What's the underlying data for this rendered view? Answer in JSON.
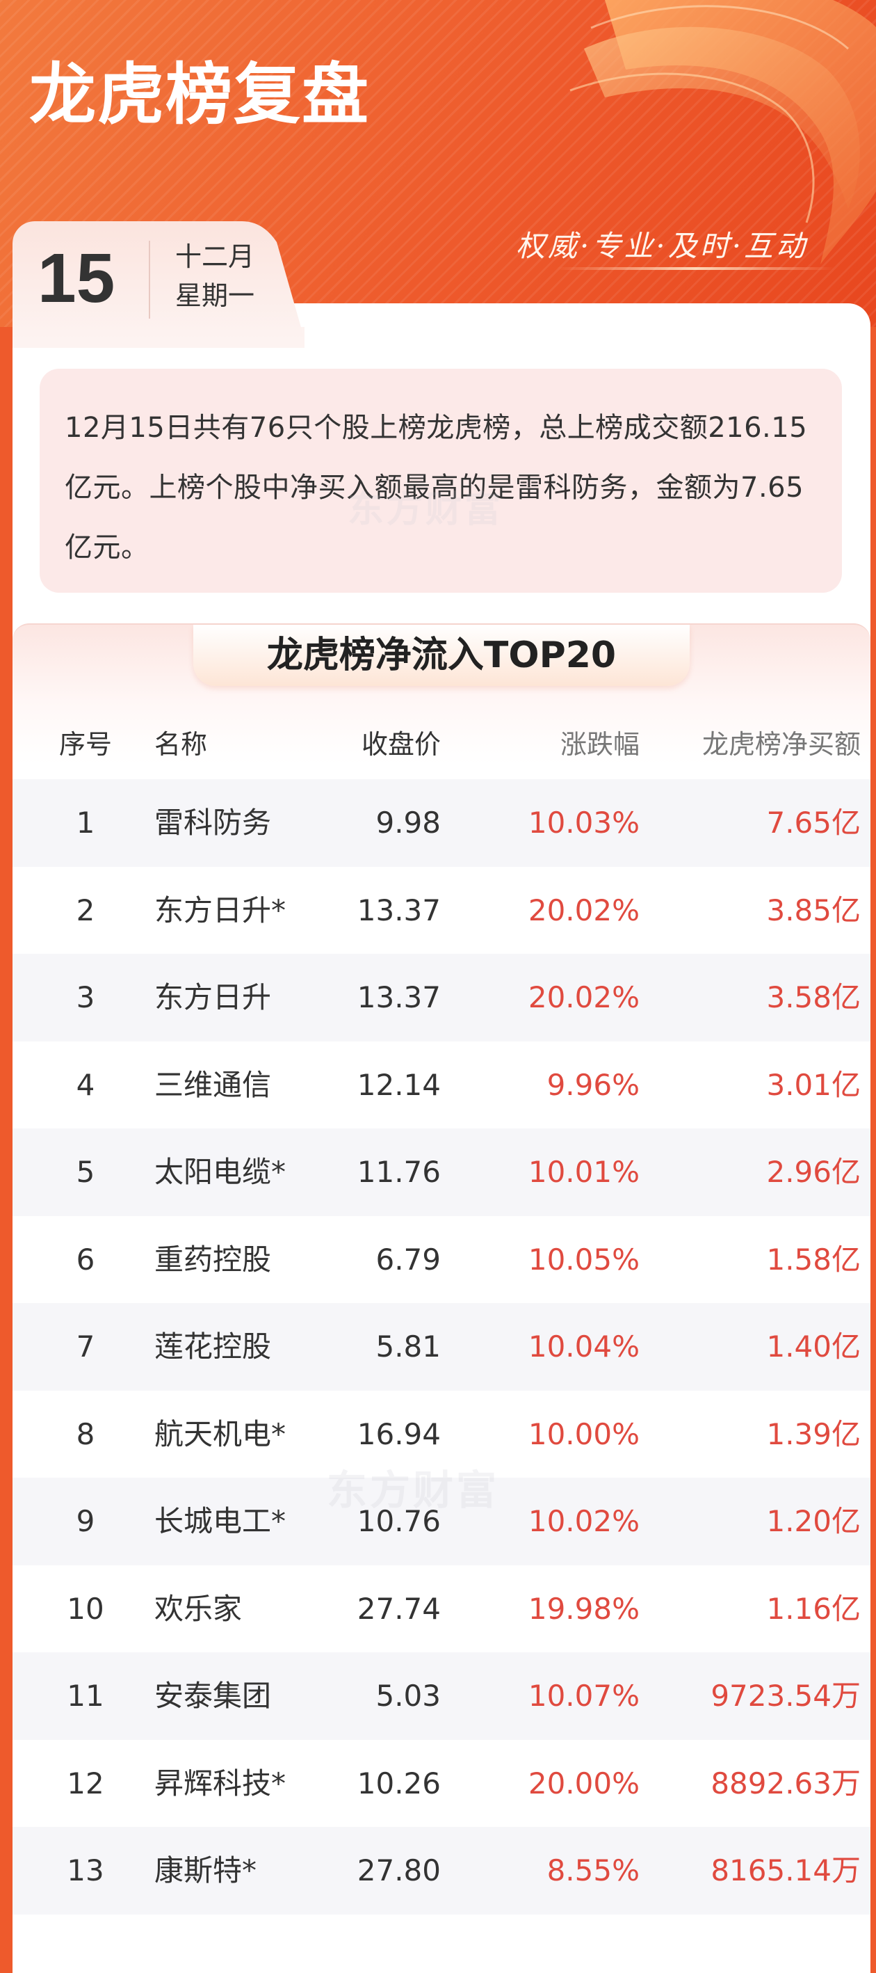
{
  "header": {
    "title": "龙虎榜复盘",
    "slogan": "权威·专业·及时·互动"
  },
  "date": {
    "day": "15",
    "month": "十二月",
    "weekday": "星期一"
  },
  "summary": {
    "text": "12月15日共有76只个股上榜龙虎榜，总上榜成交额216.15亿元。上榜个股中净买入额最高的是雷科防务，金额为7.65亿元。"
  },
  "watermark": "东方财富",
  "table": {
    "title": "龙虎榜净流入TOP20",
    "headers": {
      "rank": "序号",
      "name": "名称",
      "price": "收盘价",
      "change": "涨跌幅",
      "net_buy": "龙虎榜净买额"
    },
    "rows": [
      {
        "rank": "1",
        "name": "雷科防务",
        "price": "9.98",
        "change": "10.03%",
        "net_buy": "7.65亿"
      },
      {
        "rank": "2",
        "name": "东方日升*",
        "price": "13.37",
        "change": "20.02%",
        "net_buy": "3.85亿"
      },
      {
        "rank": "3",
        "name": "东方日升",
        "price": "13.37",
        "change": "20.02%",
        "net_buy": "3.58亿"
      },
      {
        "rank": "4",
        "name": "三维通信",
        "price": "12.14",
        "change": "9.96%",
        "net_buy": "3.01亿"
      },
      {
        "rank": "5",
        "name": "太阳电缆*",
        "price": "11.76",
        "change": "10.01%",
        "net_buy": "2.96亿"
      },
      {
        "rank": "6",
        "name": "重药控股",
        "price": "6.79",
        "change": "10.05%",
        "net_buy": "1.58亿"
      },
      {
        "rank": "7",
        "name": "莲花控股",
        "price": "5.81",
        "change": "10.04%",
        "net_buy": "1.40亿"
      },
      {
        "rank": "8",
        "name": "航天机电*",
        "price": "16.94",
        "change": "10.00%",
        "net_buy": "1.39亿"
      },
      {
        "rank": "9",
        "name": "长城电工*",
        "price": "10.76",
        "change": "10.02%",
        "net_buy": "1.20亿"
      },
      {
        "rank": "10",
        "name": "欢乐家",
        "price": "27.74",
        "change": "19.98%",
        "net_buy": "1.16亿"
      },
      {
        "rank": "11",
        "name": "安泰集团",
        "price": "5.03",
        "change": "10.07%",
        "net_buy": "9723.54万"
      },
      {
        "rank": "12",
        "name": "昇辉科技*",
        "price": "10.26",
        "change": "20.00%",
        "net_buy": "8892.63万"
      },
      {
        "rank": "13",
        "name": "康斯特*",
        "price": "27.80",
        "change": "8.55%",
        "net_buy": "8165.14万"
      }
    ]
  },
  "colors": {
    "header_orange": "#ee5a2c",
    "gain_red": "#e04a3f",
    "summary_bg": "#fce9e8",
    "row_alt_bg": "#f6f6f9"
  }
}
